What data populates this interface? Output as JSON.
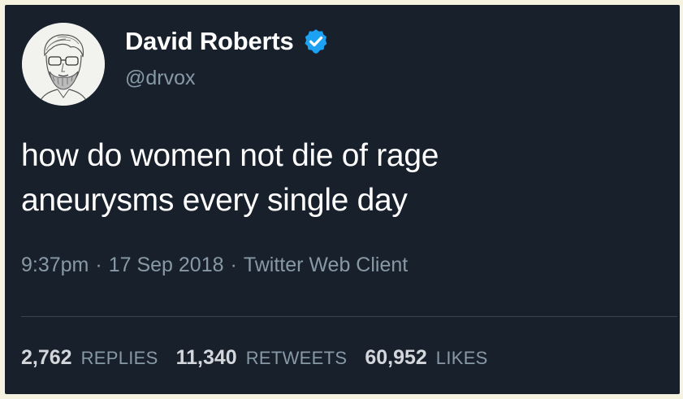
{
  "tweet": {
    "author": {
      "display_name": "David Roberts",
      "handle": "@drvox",
      "verified": true,
      "avatar_icon": "user-sketch-portrait"
    },
    "text_lines": [
      "how do women not die of rage",
      "aneurysms every single day"
    ],
    "meta": {
      "time": "9:37pm",
      "separator": "·",
      "date": "17 Sep 2018",
      "client": "Twitter Web Client"
    },
    "stats": {
      "replies_count": "2,762",
      "replies_label": "REPLIES",
      "retweets_count": "11,340",
      "retweets_label": "RETWEETS",
      "likes_count": "60,952",
      "likes_label": "LIKES"
    }
  },
  "colors": {
    "background": "#18202c",
    "text_primary": "#ffffff",
    "text_secondary": "#8899a6",
    "verified_badge": "#1da1f2",
    "frame": "#f5f3df"
  }
}
